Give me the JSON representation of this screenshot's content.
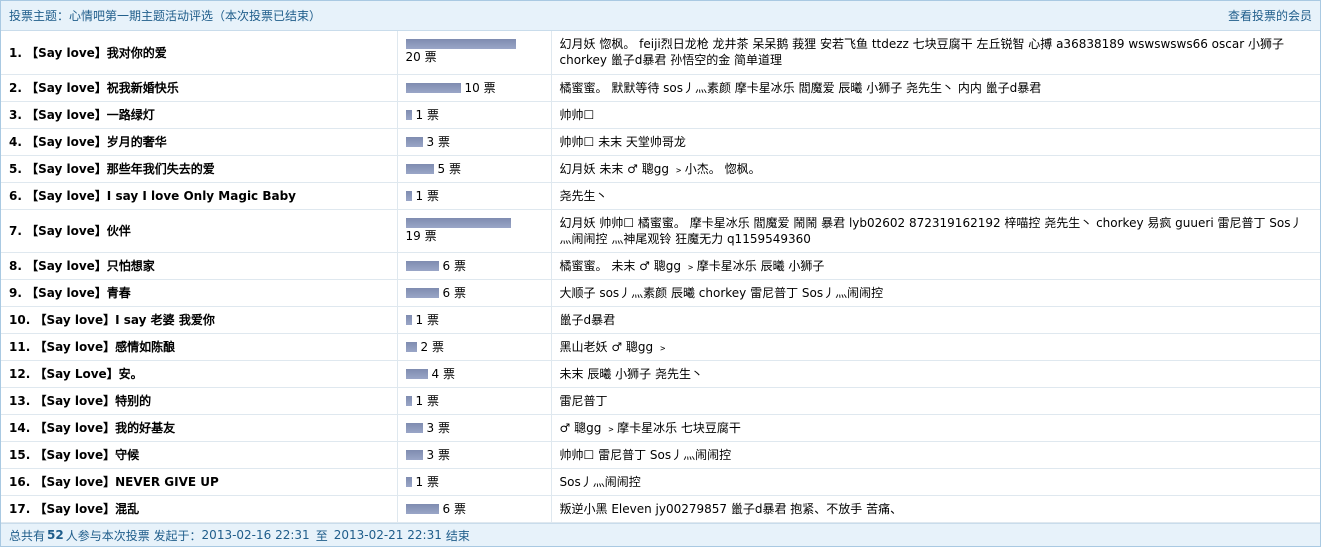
{
  "header": {
    "title": "投票主题：心情吧第一期主题活动评选（本次投票已结束）",
    "members_link": "查看投票的会员"
  },
  "colors": {
    "header_bg": "#e7f2fa",
    "header_text": "#1f5d8b",
    "bar": "#8a96b9",
    "border": "#a9c9e2"
  },
  "items": [
    {
      "num": "1.",
      "title": "【Say love】我对你的爱",
      "votes": 20,
      "votes_label": "20 票",
      "voters": "幻月妖 惚枫。 feiji烈日龙枪 龙井茶 呆呆鹅 莪狸 安若飞鱼 ttdezz 七块豆腐干 左丘锐智 心搏 a36838189 wswswsws66 oscar 小狮子 chorkey 巤子d暴君 孙悟空的金 简单道理"
    },
    {
      "num": "2.",
      "title": "【Say love】祝我新婚快乐",
      "votes": 10,
      "votes_label": "10 票",
      "voters": "橘蜜蜜。 默默等待 sos丿灬素颜 摩卡星冰乐 閻魔爱 辰曦 小狮子 尧先生丶 内内 巤子d暴君"
    },
    {
      "num": "3.",
      "title": "【Say love】一路绿灯",
      "votes": 1,
      "votes_label": "1 票",
      "voters": "帅帅☐"
    },
    {
      "num": "4.",
      "title": "【Say love】岁月的奢华",
      "votes": 3,
      "votes_label": "3 票",
      "voters": "帅帅☐ 未末 天堂帅哥龙"
    },
    {
      "num": "5.",
      "title": "【Say love】那些年我们失去的爱",
      "votes": 5,
      "votes_label": "5 票",
      "voters": "幻月妖 未末 ♂ 聰gg ﹥小杰。 惚枫。"
    },
    {
      "num": "6.",
      "title": "【Say love】I say I love Only Magic Baby",
      "votes": 1,
      "votes_label": "1 票",
      "voters": "尧先生丶"
    },
    {
      "num": "7.",
      "title": "【Say love】伙伴",
      "votes": 19,
      "votes_label": "19 票",
      "voters": "幻月妖 帅帅☐ 橘蜜蜜。 摩卡星冰乐 閻魔爱 鬧鬧 暴君 lyb02602 872319162192 梓喵控 尧先生丶 chorkey 易疯 guueri 雷尼普丁 Sos丿灬闹闹控 灬神尾观铃 狂魔无力 q1159549360"
    },
    {
      "num": "8.",
      "title": "【Say love】只怕想家",
      "votes": 6,
      "votes_label": "6 票",
      "voters": "橘蜜蜜。 未末 ♂ 聰gg ﹥摩卡星冰乐 辰曦 小狮子"
    },
    {
      "num": "9.",
      "title": "【Say love】青春",
      "votes": 6,
      "votes_label": "6 票",
      "voters": "大顺子 sos丿灬素颜 辰曦 chorkey 雷尼普丁 Sos丿灬闹闹控"
    },
    {
      "num": "10.",
      "title": "【Say love】I say 老婆 我爱你",
      "votes": 1,
      "votes_label": "1 票",
      "voters": "巤子d暴君"
    },
    {
      "num": "11.",
      "title": "【Say love】感情如陈酿",
      "votes": 2,
      "votes_label": "2 票",
      "voters": "黑山老妖 ♂ 聰gg ﹥"
    },
    {
      "num": "12.",
      "title": "【Say Love】安。",
      "votes": 4,
      "votes_label": "4 票",
      "voters": "未末 辰曦 小狮子 尧先生丶"
    },
    {
      "num": "13.",
      "title": "【Say love】特别的",
      "votes": 1,
      "votes_label": "1 票",
      "voters": "雷尼普丁"
    },
    {
      "num": "14.",
      "title": "【Say love】我的好基友",
      "votes": 3,
      "votes_label": "3 票",
      "voters": "♂ 聰gg ﹥摩卡星冰乐 七块豆腐干"
    },
    {
      "num": "15.",
      "title": "【Say love】守候",
      "votes": 3,
      "votes_label": "3 票",
      "voters": "帅帅☐ 雷尼普丁 Sos丿灬闹闹控"
    },
    {
      "num": "16.",
      "title": "【Say love】NEVER GIVE UP",
      "votes": 1,
      "votes_label": "1 票",
      "voters": "Sos丿灬闹闹控"
    },
    {
      "num": "17.",
      "title": "【Say love】混乱",
      "votes": 6,
      "votes_label": "6 票",
      "voters": "叛逆小黑 Eleven jy00279857 巤子d暴君 抱紧、不放手 苦痛、"
    }
  ],
  "footer": {
    "prefix": "总共有",
    "count": "52",
    "middle": "人参与本次投票 发起于：",
    "start": "2013-02-16 22:31",
    "to": "至",
    "end": "2013-02-21 22:31",
    "suffix": "结束"
  }
}
